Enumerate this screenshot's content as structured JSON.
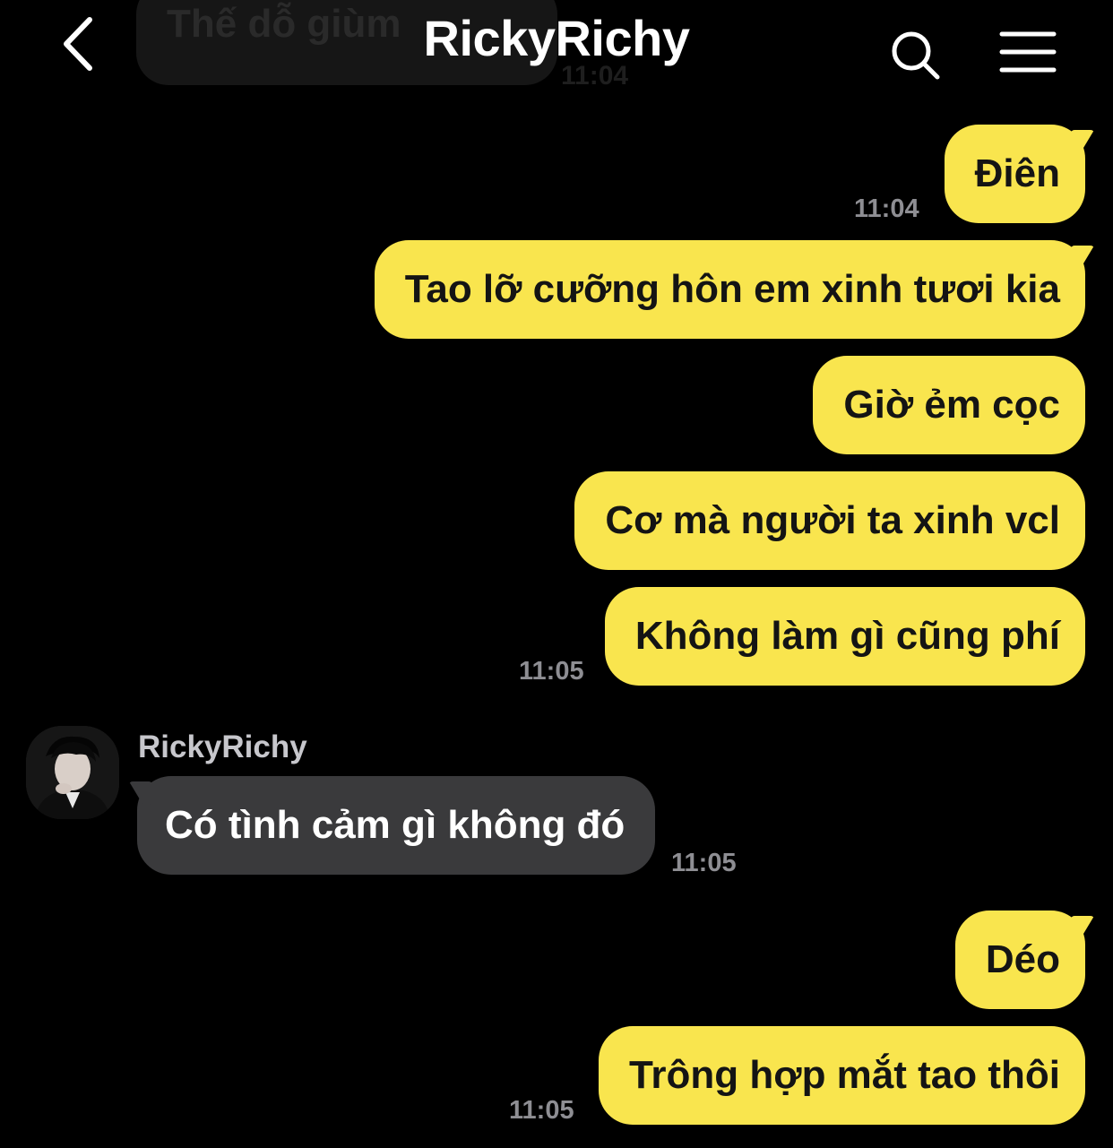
{
  "header": {
    "title": "RickyRichy",
    "back_icon": "chevron-left-icon",
    "search_icon": "search-icon",
    "menu_icon": "hamburger-menu-icon"
  },
  "ghost": {
    "text": "Thế dỗ giùm",
    "time": "11:04"
  },
  "messages": [
    {
      "text": "Điên",
      "time": "11:04",
      "side": "out"
    },
    {
      "text": "Tao lỡ cưỡng hôn em xinh tươi kia",
      "side": "out"
    },
    {
      "text": "Giờ ẻm cọc",
      "side": "out"
    },
    {
      "text": "Cơ mà người ta xinh vcl",
      "side": "out"
    },
    {
      "text": "Không làm gì cũng phí",
      "time": "11:05",
      "side": "out"
    },
    {
      "sender": "RickyRichy",
      "text": "Có tình cảm gì không đó",
      "time": "11:05",
      "side": "in"
    },
    {
      "text": "Déo",
      "side": "out"
    },
    {
      "text": "Trông hợp mắt tao thôi",
      "time": "11:05",
      "side": "out"
    }
  ],
  "colors": {
    "background": "#000000",
    "outgoing_bubble": "#f9e54e",
    "incoming_bubble": "#3a3a3c",
    "timestamp": "#8e8e93"
  }
}
